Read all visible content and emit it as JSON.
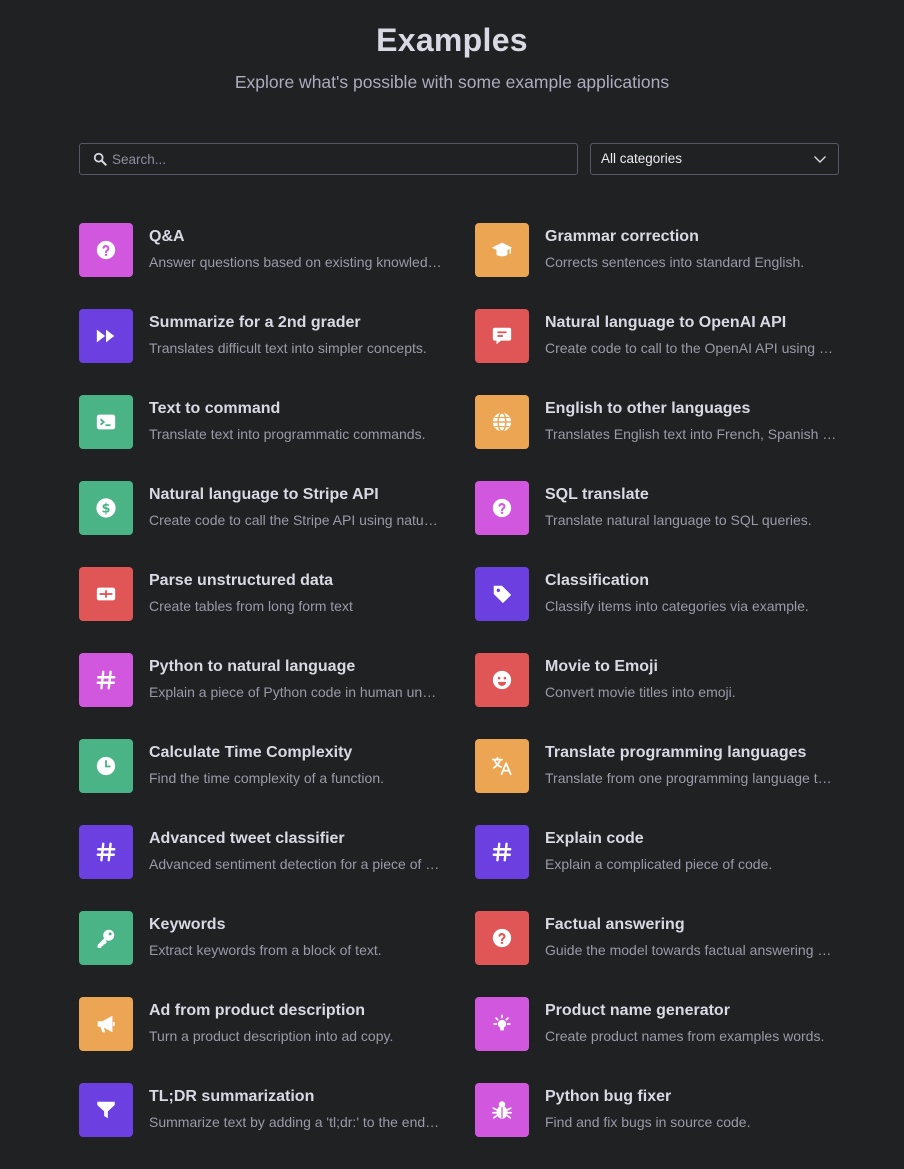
{
  "header": {
    "title": "Examples",
    "subtitle": "Explore what's possible with some example applications"
  },
  "search": {
    "placeholder": "Search..."
  },
  "category_select": {
    "selected": "All categories"
  },
  "colors": {
    "pink": "#d158de",
    "orange": "#eca552",
    "purple": "#6b3fe0",
    "red": "#e05555",
    "green": "#4ab487"
  },
  "examples": [
    {
      "title": "Q&A",
      "description": "Answer questions based on existing knowledge.",
      "color": "pink",
      "icon": "question-icon"
    },
    {
      "title": "Grammar correction",
      "description": "Corrects sentences into standard English.",
      "color": "orange",
      "icon": "graduation-cap-icon"
    },
    {
      "title": "Summarize for a 2nd grader",
      "description": "Translates difficult text into simpler concepts.",
      "color": "purple",
      "icon": "fast-forward-icon"
    },
    {
      "title": "Natural language to OpenAI API",
      "description": "Create code to call to the OpenAI API using a natural language instruction.",
      "color": "red",
      "icon": "chat-icon"
    },
    {
      "title": "Text to command",
      "description": "Translate text into programmatic commands.",
      "color": "green",
      "icon": "terminal-icon"
    },
    {
      "title": "English to other languages",
      "description": "Translates English text into French, Spanish and Japanese.",
      "color": "orange",
      "icon": "globe-icon"
    },
    {
      "title": "Natural language to Stripe API",
      "description": "Create code to call the Stripe API using natural language.",
      "color": "green",
      "icon": "dollar-icon"
    },
    {
      "title": "SQL translate",
      "description": "Translate natural language to SQL queries.",
      "color": "pink",
      "icon": "question-icon"
    },
    {
      "title": "Parse unstructured data",
      "description": "Create tables from long form text",
      "color": "red",
      "icon": "table-icon"
    },
    {
      "title": "Classification",
      "description": "Classify items into categories via example.",
      "color": "purple",
      "icon": "tag-icon"
    },
    {
      "title": "Python to natural language",
      "description": "Explain a piece of Python code in human understandable language.",
      "color": "pink",
      "icon": "hashtag-icon"
    },
    {
      "title": "Movie to Emoji",
      "description": "Convert movie titles into emoji.",
      "color": "red",
      "icon": "smiley-icon"
    },
    {
      "title": "Calculate Time Complexity",
      "description": "Find the time complexity of a function.",
      "color": "green",
      "icon": "clock-icon"
    },
    {
      "title": "Translate programming languages",
      "description": "Translate from one programming language to another.",
      "color": "orange",
      "icon": "translate-icon"
    },
    {
      "title": "Advanced tweet classifier",
      "description": "Advanced sentiment detection for a piece of text.",
      "color": "purple",
      "icon": "hashtag-icon"
    },
    {
      "title": "Explain code",
      "description": "Explain a complicated piece of code.",
      "color": "purple",
      "icon": "hashtag-icon"
    },
    {
      "title": "Keywords",
      "description": "Extract keywords from a block of text.",
      "color": "green",
      "icon": "key-icon"
    },
    {
      "title": "Factual answering",
      "description": "Guide the model towards factual answering by showing it how to respond.",
      "color": "red",
      "icon": "question-icon"
    },
    {
      "title": "Ad from product description",
      "description": "Turn a product description into ad copy.",
      "color": "orange",
      "icon": "megaphone-icon"
    },
    {
      "title": "Product name generator",
      "description": "Create product names from examples words.",
      "color": "pink",
      "icon": "lightbulb-icon"
    },
    {
      "title": "TL;DR summarization",
      "description": "Summarize text by adding a 'tl;dr:' to the end of a text passage.",
      "color": "purple",
      "icon": "funnel-icon"
    },
    {
      "title": "Python bug fixer",
      "description": "Find and fix bugs in source code.",
      "color": "pink",
      "icon": "bug-icon"
    }
  ]
}
